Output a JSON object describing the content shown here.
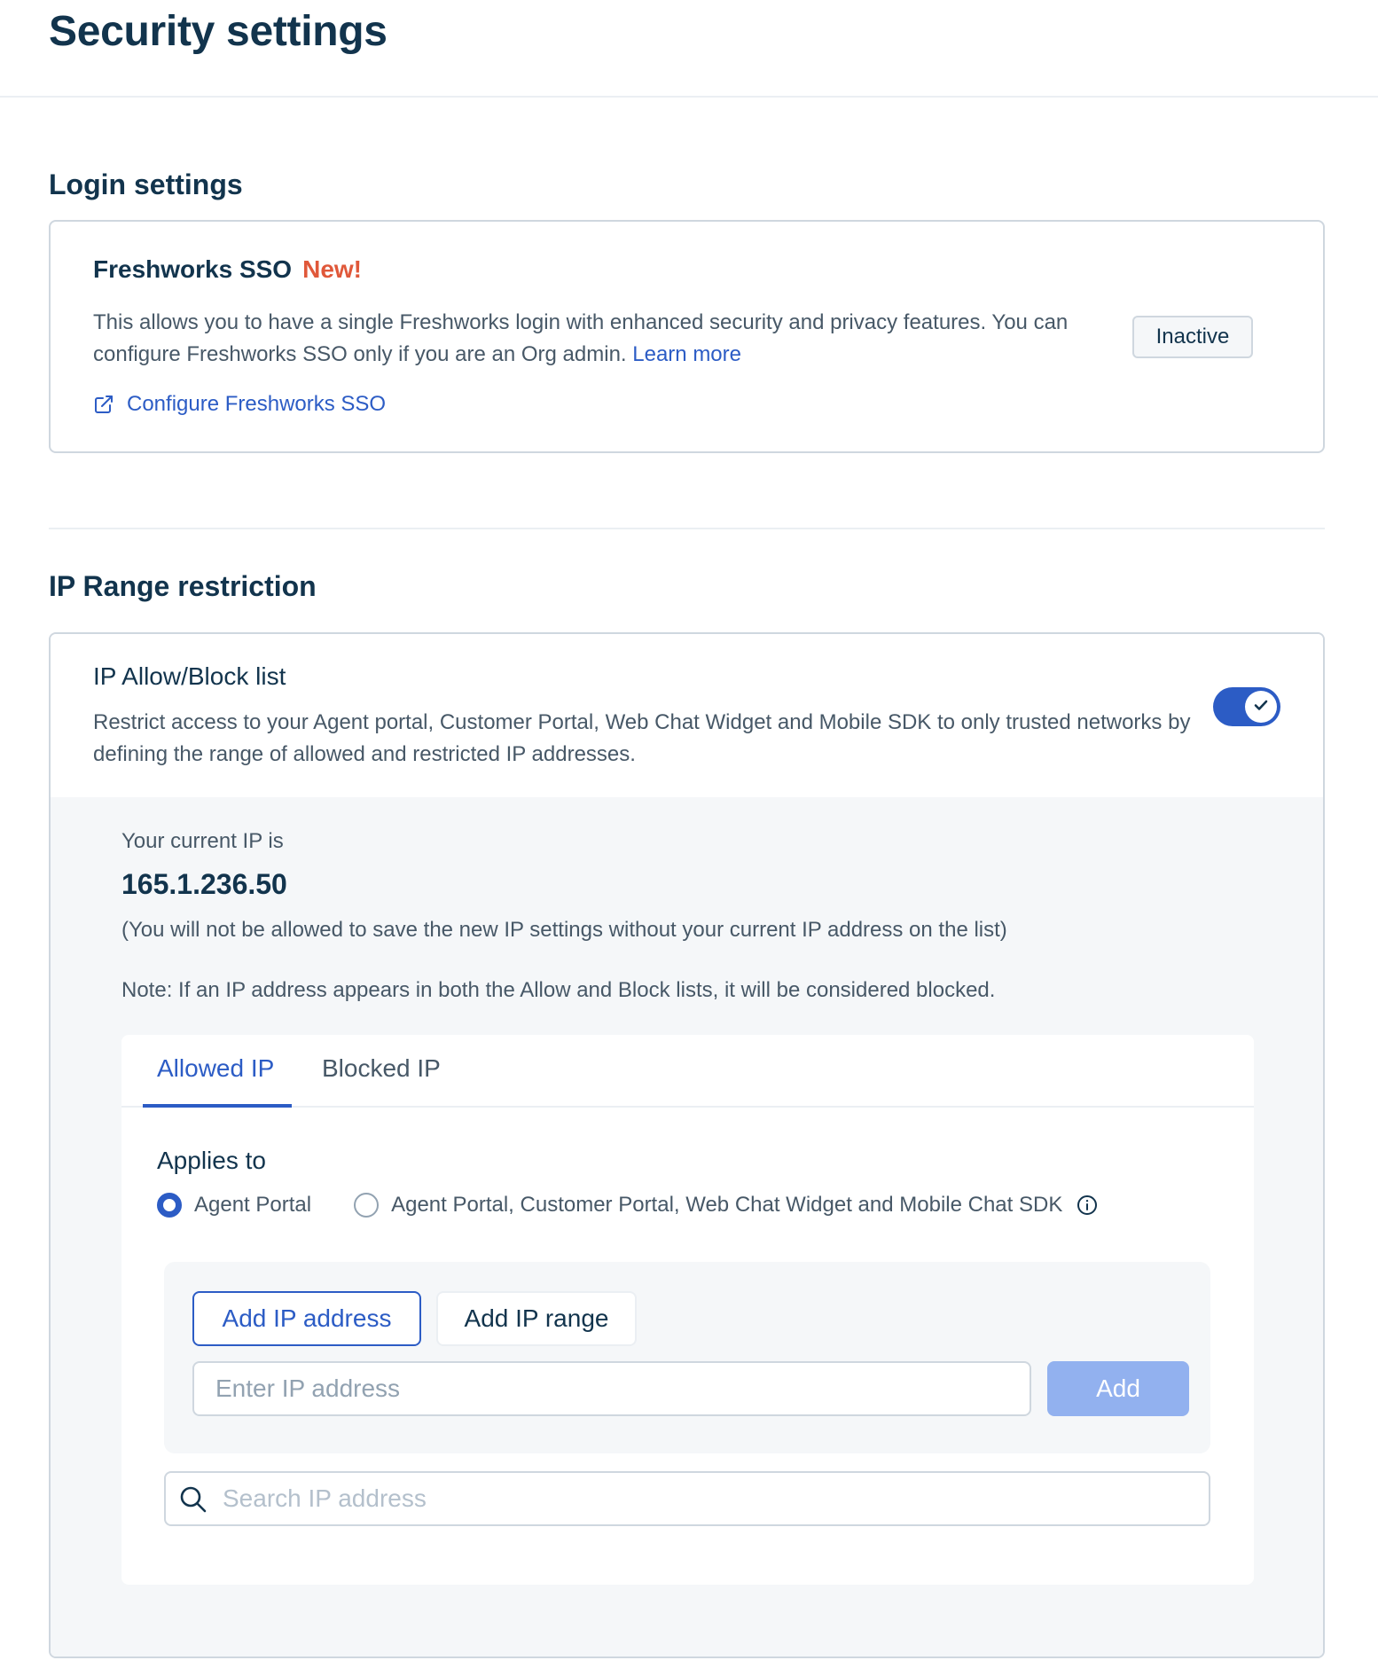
{
  "page": {
    "title": "Security settings"
  },
  "login": {
    "section_title": "Login settings",
    "sso_title": "Freshworks SSO",
    "sso_new_badge": "New!",
    "sso_description": "This allows you to have a single Freshworks login with enhanced security and privacy features. You can configure Freshworks SSO only if you are an Org admin.",
    "learn_more": "Learn more",
    "configure_link": "Configure Freshworks SSO",
    "status": "Inactive"
  },
  "ip": {
    "section_title": "IP Range restriction",
    "card_title": "IP Allow/Block list",
    "card_description": "Restrict access to your Agent portal, Customer Portal, Web Chat Widget and Mobile SDK to only trusted networks by defining the range of allowed and restricted IP addresses.",
    "toggle_on": true,
    "current_ip_label": "Your current IP is",
    "current_ip": "165.1.236.50",
    "current_ip_note": "(You will not be allowed to save the new IP settings without your current IP address on the list)",
    "note": "Note: If an IP address appears in both the Allow and Block lists, it will be considered blocked.",
    "tabs": [
      {
        "label": "Allowed IP",
        "active": true
      },
      {
        "label": "Blocked IP",
        "active": false
      }
    ],
    "applies_to": "Applies to",
    "radio_options": [
      {
        "label": "Agent Portal",
        "selected": true
      },
      {
        "label": "Agent Portal, Customer Portal, Web Chat Widget and Mobile Chat SDK",
        "selected": false
      }
    ],
    "add_ip_address_btn": "Add IP address",
    "add_ip_range_btn": "Add IP range",
    "ip_input_placeholder": "Enter IP address",
    "add_btn": "Add",
    "search_placeholder": "Search IP address"
  },
  "colors": {
    "primary": "#2c5cc5",
    "text_dark": "#12344d",
    "text_muted": "#475867",
    "new_badge": "#e0583a",
    "add_disabled": "#92b1ef"
  },
  "icons": [
    "external-link-icon",
    "checkmark-icon",
    "info-icon",
    "search-icon"
  ]
}
